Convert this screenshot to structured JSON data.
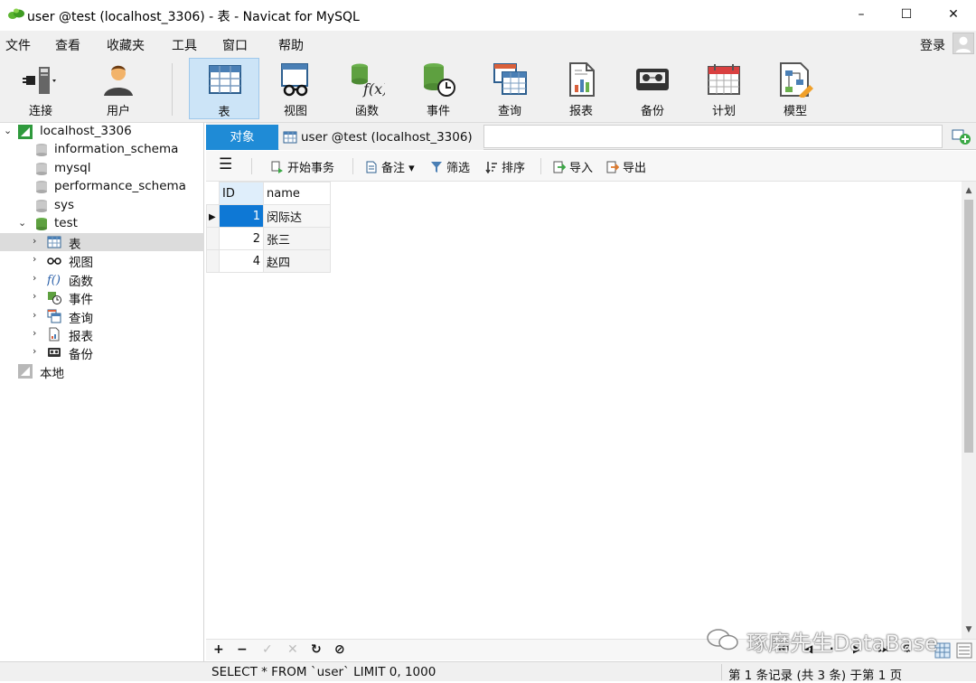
{
  "window": {
    "title": "user @test (localhost_3306) - 表 - Navicat for MySQL",
    "min": "–",
    "max": "☐",
    "close": "✕"
  },
  "menu": {
    "items": [
      "文件",
      "查看",
      "收藏夹",
      "工具",
      "窗口",
      "帮助"
    ],
    "login": "登录"
  },
  "toolbar": {
    "items": [
      {
        "label": "连接",
        "icon": "plug-icon"
      },
      {
        "label": "用户",
        "icon": "user-icon"
      },
      {
        "label": "表",
        "icon": "table-icon",
        "active": true
      },
      {
        "label": "视图",
        "icon": "view-icon"
      },
      {
        "label": "函数",
        "icon": "function-icon"
      },
      {
        "label": "事件",
        "icon": "event-icon"
      },
      {
        "label": "查询",
        "icon": "query-icon"
      },
      {
        "label": "报表",
        "icon": "report-icon"
      },
      {
        "label": "备份",
        "icon": "backup-icon"
      },
      {
        "label": "计划",
        "icon": "schedule-icon"
      },
      {
        "label": "模型",
        "icon": "model-icon"
      }
    ]
  },
  "tree": {
    "connection": "localhost_3306",
    "databases": [
      "information_schema",
      "mysql",
      "performance_schema",
      "sys",
      "test"
    ],
    "test_children": [
      "表",
      "视图",
      "函数",
      "事件",
      "查询",
      "报表",
      "备份"
    ],
    "local": "本地"
  },
  "tabs": {
    "objects": "对象",
    "current": "user @test (localhost_3306) ..."
  },
  "subtoolbar": {
    "begin_transaction": "开始事务",
    "comment": "备注",
    "filter": "筛选",
    "sort": "排序",
    "import": "导入",
    "export": "导出"
  },
  "grid": {
    "columns": [
      "ID",
      "name"
    ],
    "rows": [
      {
        "id": "1",
        "name": "闵际达"
      },
      {
        "id": "2",
        "name": "张三"
      },
      {
        "id": "4",
        "name": "赵四"
      }
    ]
  },
  "bottom_nav": {
    "add": "+",
    "remove": "−",
    "apply": "✓",
    "discard": "✕",
    "refresh": "↻",
    "stop": "⊘"
  },
  "status": {
    "sql": "SELECT * FROM `user` LIMIT 0, 1000",
    "records": "第 1 条记录 (共 3 条) 于第 1 页"
  },
  "watermark": "琢磨先生DataBase",
  "colors": {
    "accent": "#1f8bd6",
    "selection": "#0e78d5",
    "toolbar_active": "#cce4f7"
  }
}
